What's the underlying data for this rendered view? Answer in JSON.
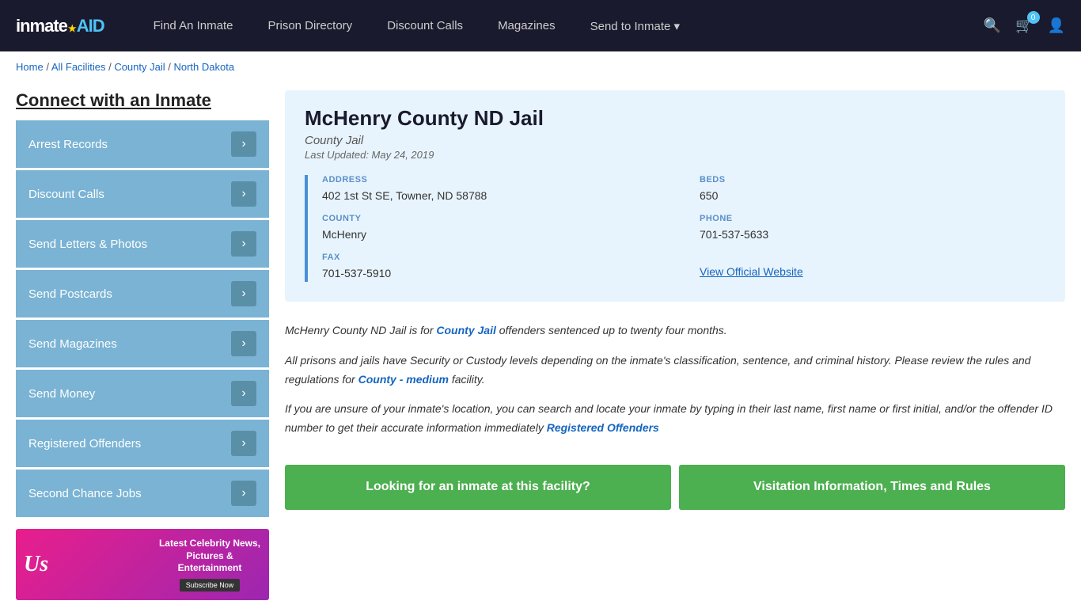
{
  "nav": {
    "logo": "inmate",
    "logo_aid": "AID",
    "links": [
      {
        "label": "Find An Inmate",
        "id": "find-inmate"
      },
      {
        "label": "Prison Directory",
        "id": "prison-directory"
      },
      {
        "label": "Discount Calls",
        "id": "discount-calls"
      },
      {
        "label": "Magazines",
        "id": "magazines"
      },
      {
        "label": "Send to Inmate ▾",
        "id": "send-to-inmate"
      }
    ],
    "cart_count": "0"
  },
  "breadcrumb": {
    "home": "Home",
    "separator1": " / ",
    "all_facilities": "All Facilities",
    "separator2": " / ",
    "county_jail": "County Jail",
    "separator3": " / ",
    "state": "North Dakota"
  },
  "sidebar": {
    "title": "Connect with an Inmate",
    "items": [
      {
        "label": "Arrest Records"
      },
      {
        "label": "Discount Calls"
      },
      {
        "label": "Send Letters & Photos"
      },
      {
        "label": "Send Postcards"
      },
      {
        "label": "Send Magazines"
      },
      {
        "label": "Send Money"
      },
      {
        "label": "Registered Offenders"
      },
      {
        "label": "Second Chance Jobs"
      }
    ],
    "ad": {
      "logo": "Us",
      "title": "Latest Celebrity News, Pictures & Entertainment",
      "subscribe": "Subscribe Now"
    }
  },
  "facility": {
    "name": "McHenry County ND Jail",
    "type": "County Jail",
    "last_updated": "Last Updated: May 24, 2019",
    "address_label": "ADDRESS",
    "address_value": "402 1st St SE, Towner, ND 58788",
    "beds_label": "BEDS",
    "beds_value": "650",
    "county_label": "COUNTY",
    "county_value": "McHenry",
    "phone_label": "PHONE",
    "phone_value": "701-537-5633",
    "fax_label": "FAX",
    "fax_value": "701-537-5910",
    "website_label": "View Official Website",
    "website_url": "#"
  },
  "description": {
    "para1_pre": "McHenry County ND Jail is for ",
    "para1_link": "County Jail",
    "para1_post": " offenders sentenced up to twenty four months.",
    "para2_pre": "All prisons and jails have Security or Custody levels depending on the inmate's classification, sentence, and criminal history. Please review the rules and regulations for ",
    "para2_link": "County - medium",
    "para2_post": " facility.",
    "para3": "If you are unsure of your inmate's location, you can search and locate your inmate by typing in their last name, first name or first initial, and/or the offender ID number to get their accurate information immediately",
    "para3_link": "Registered Offenders"
  },
  "buttons": {
    "looking": "Looking for an inmate at this facility?",
    "visitation": "Visitation Information, Times and Rules"
  }
}
